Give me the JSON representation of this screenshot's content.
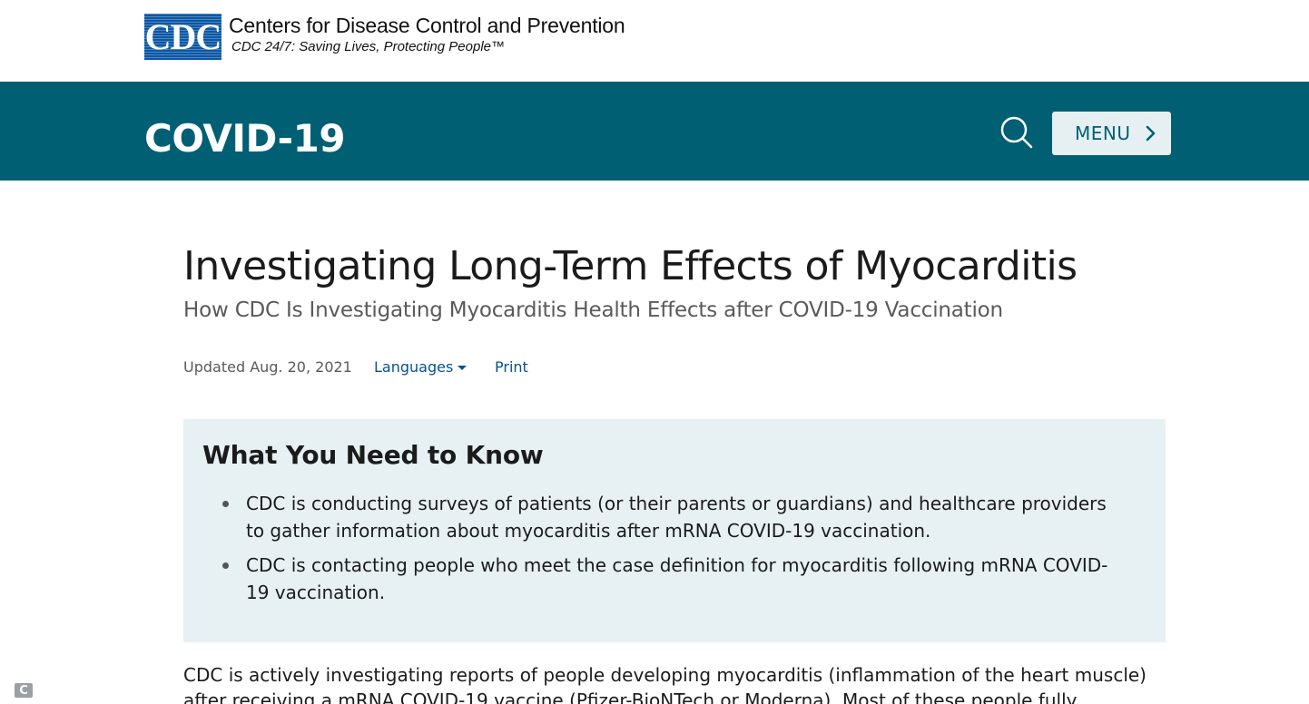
{
  "header": {
    "logo_letters": "CDC",
    "org_name": "Centers for Disease Control and Prevention",
    "tagline": "CDC 24/7: Saving Lives, Protecting People™"
  },
  "banner": {
    "title": "COVID-19",
    "search_icon": "search-icon",
    "menu_label": "MENU",
    "menu_icon": "chevron-right-icon"
  },
  "main": {
    "title": "Investigating Long-Term Effects of Myocarditis",
    "subtitle": "How CDC Is Investigating Myocarditis Health Effects after COVID-19 Vaccination",
    "updated": "Updated Aug. 20, 2021",
    "languages_label": "Languages",
    "print_label": "Print"
  },
  "callout": {
    "title": "What You Need to Know",
    "items": [
      "CDC is conducting surveys of patients (or their parents or guardians) and healthcare providers to gather information about myocarditis after mRNA COVID-19 vaccination.",
      "CDC is contacting people who meet the case definition for myocarditis following mRNA COVID-19 vaccination."
    ]
  },
  "body": {
    "paragraph": "CDC is actively investigating reports of people developing myocarditis (inflammation of the heart muscle) after receiving a mRNA COVID-19 vaccine (Pfizer-BioNTech or Moderna). Most of these people fully recover, but"
  },
  "corner_widget": {
    "glyph": "C"
  },
  "colors": {
    "banner": "#005f73",
    "link": "#075290",
    "callout_bg": "#e7f1f4",
    "logo_blue": "#0b57a4"
  }
}
